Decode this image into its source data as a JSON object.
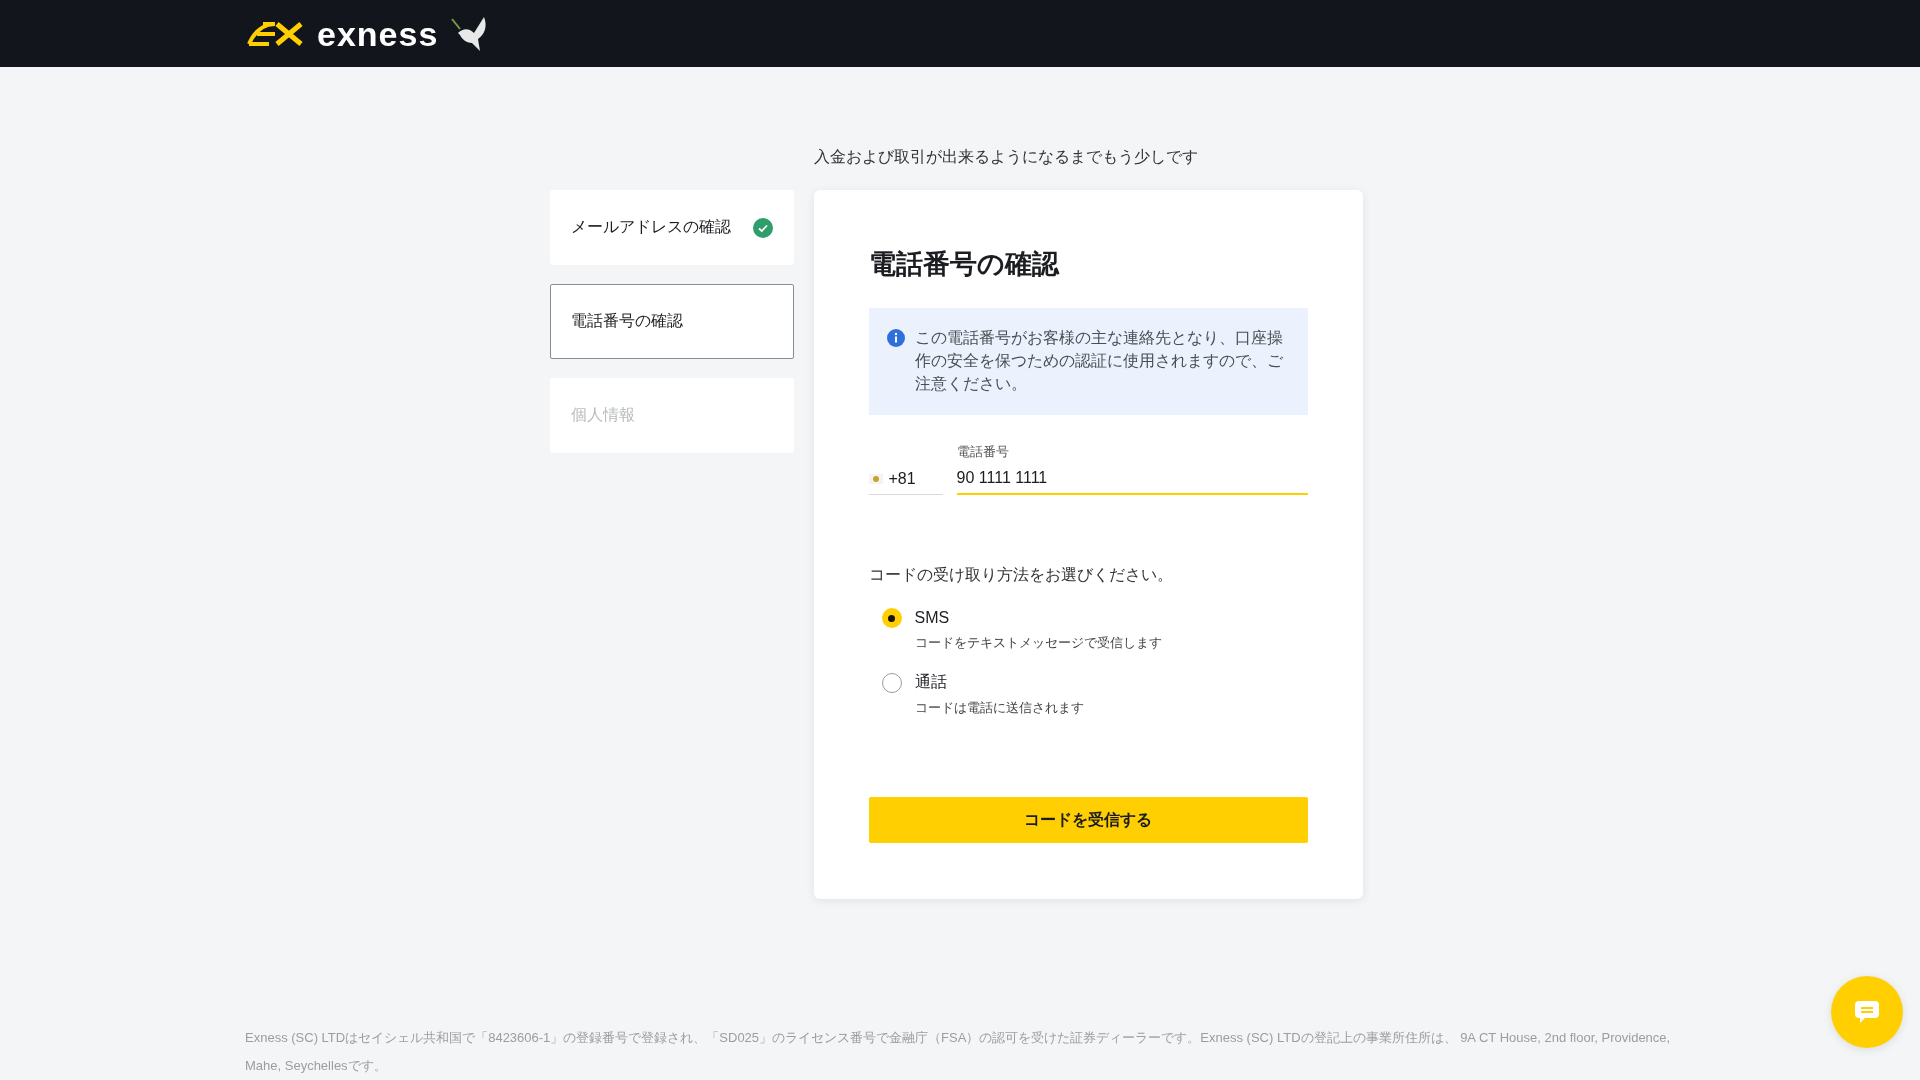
{
  "header": {
    "brand": "exness"
  },
  "subtitle": "入金および取引が出来るようになるまでもう少しです",
  "steps": [
    {
      "label": "メールアドレスの確認",
      "completed": true,
      "selected": false,
      "disabled": false
    },
    {
      "label": "電話番号の確認",
      "completed": false,
      "selected": true,
      "disabled": false
    },
    {
      "label": "個人情報",
      "completed": false,
      "selected": false,
      "disabled": true
    }
  ],
  "card": {
    "title": "電話番号の確認",
    "info": "この電話番号がお客様の主な連絡先となり、口座操作の安全を保つための認証に使用されますので、ご注意ください。",
    "country_code": "+81",
    "phone_label": "電話番号",
    "phone_value": "90 1111 1111",
    "method_question": "コードの受け取り方法をお選びください。",
    "methods": [
      {
        "label": "SMS",
        "description": "コードをテキストメッセージで受信します",
        "selected": true
      },
      {
        "label": "通話",
        "description": "コードは電話に送信されます",
        "selected": false
      }
    ],
    "submit": "コードを受信する"
  },
  "footer": "Exness (SC) LTDはセイシェル共和国で「8423606-1」の登録番号で登録され、「SD025」のライセンス番号で金融庁（FSA）の認可を受けた証券ディーラーです。Exness (SC) LTDの登記上の事業所住所は、 9A CT House, 2nd floor, Providence, Mahe, Seychellesです。"
}
